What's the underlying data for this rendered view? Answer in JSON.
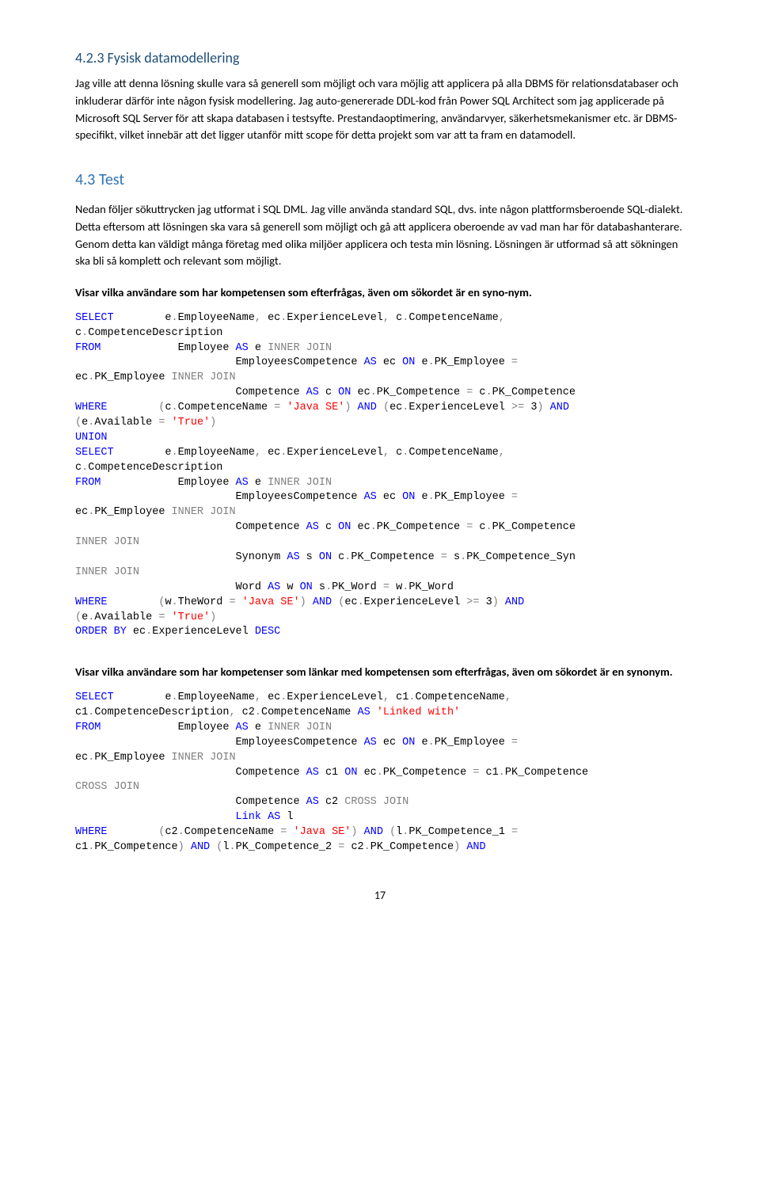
{
  "section1": {
    "heading": "4.2.3 Fysisk datamodellering",
    "para1": "Jag ville att denna lösning skulle vara så generell som möjligt och vara möjlig att applicera på alla DBMS för relationsdatabaser och inkluderar därför inte någon fysisk modellering. Jag auto-genererade DDL-kod från Power SQL Architect som jag applicerade på Microsoft SQL Server för att skapa databasen i testsyfte. Prestandaoptimering, användarvyer, säkerhetsmekanismer etc. är DBMS-specifikt, vilket innebär att det ligger utanför mitt scope för detta projekt som var att ta fram en datamodell."
  },
  "section2": {
    "heading": "4.3 Test",
    "para1": "Nedan följer sökuttrycken jag utformat i SQL DML. Jag ville använda standard SQL, dvs. inte någon plattformsberoende SQL-dialekt. Detta eftersom att lösningen ska vara så generell som möjligt och gå att applicera oberoende av vad man har för databashanterare. Genom detta kan väldigt många företag med olika miljöer applicera och testa min lösning. Lösningen är utformad så att sökningen ska bli så komplett och relevant som möjligt.",
    "bold1": "Visar vilka användare som har kompetensen som efterfrågas, även om sökordet är en syno-nym.",
    "bold2": "Visar vilka användare som har kompetenser som länkar med kompetensen som efterfrågas, även om sökordet är en synonym."
  },
  "pageNum": "17"
}
